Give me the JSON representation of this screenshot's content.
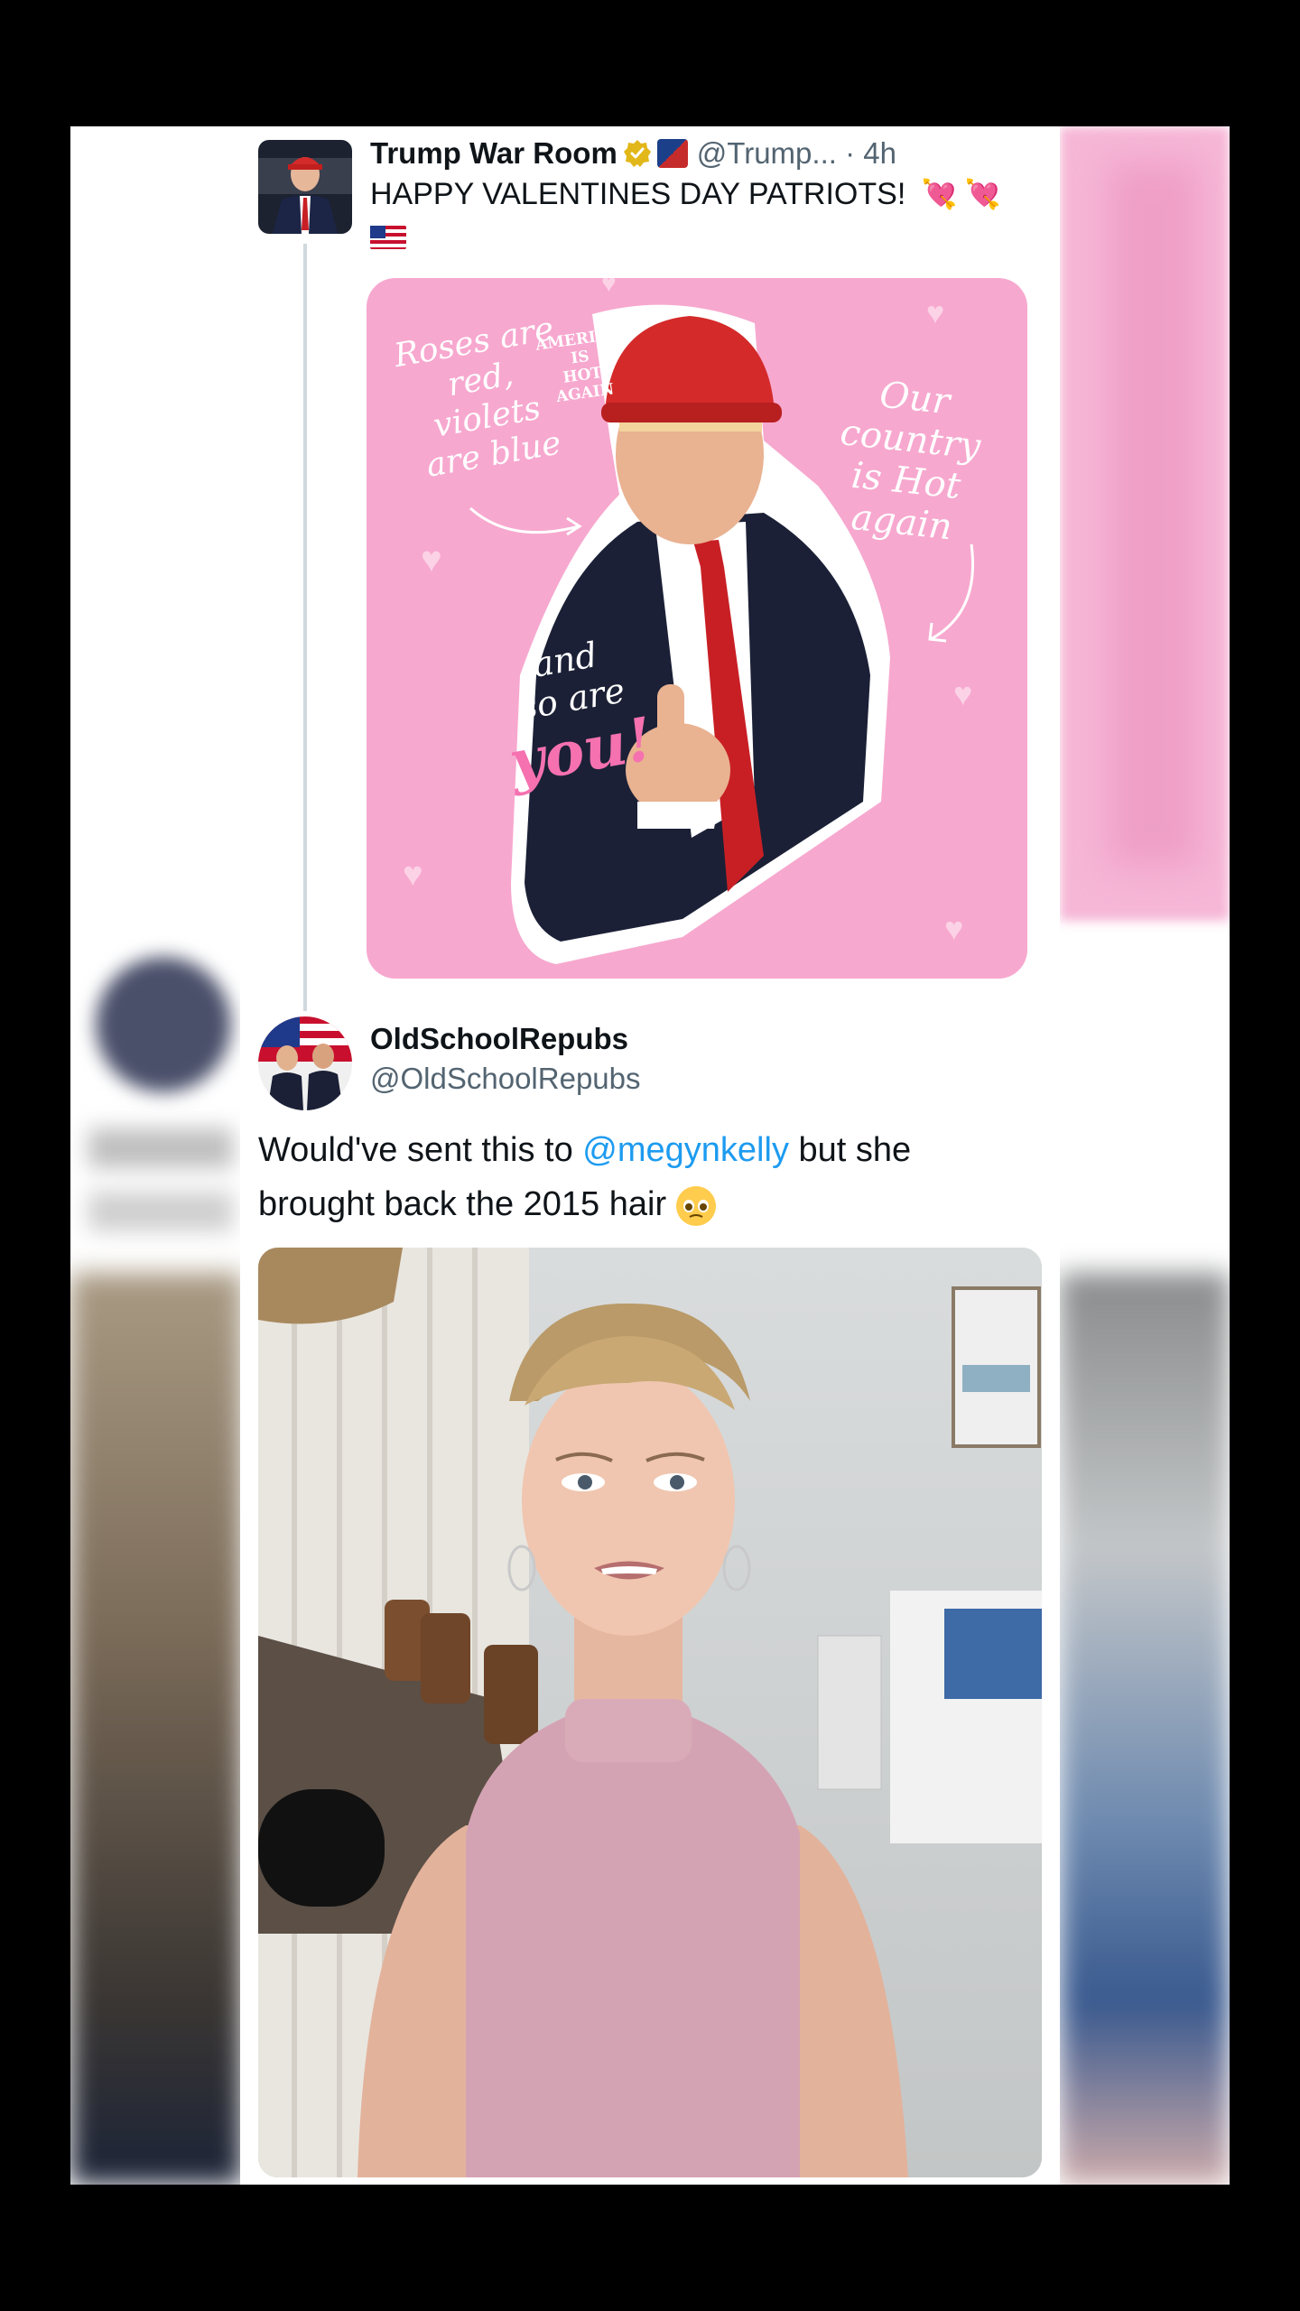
{
  "tweet1": {
    "display_name": "Trump War Room",
    "handle_time": "@Trump... · 4h",
    "text": "HAPPY VALENTINES DAY PATRIOTS!",
    "image": {
      "hat_text_line1": "AMERICA IS",
      "hat_text_line2": "HOT AGAIN",
      "left_line1": "Roses are",
      "left_line2": "red,",
      "left_line3": "violets",
      "left_line4": "are blue",
      "right_line1": "Our",
      "right_line2": "country",
      "right_line3": "is Hot",
      "right_line4": "again",
      "bottom_line1": "and",
      "bottom_line2": "so are",
      "bottom_line3": "you!"
    }
  },
  "tweet2": {
    "display_name": "OldSchoolRepubs",
    "handle": "@OldSchoolRepubs",
    "text_before": "Would've sent this to ",
    "mention": "@megynkelly",
    "text_after": " but she brought back the 2015 hair"
  },
  "icons": {
    "verified": "verified-badge-icon",
    "affiliate": "affiliate-badge-icon",
    "hearts": "heart-with-arrow-emoji",
    "flag": "us-flag-emoji",
    "pleading": "pleading-face-emoji"
  },
  "colors": {
    "card_pink": "#f7a8cf",
    "mention_blue": "#1d9bf0",
    "hat_red": "#d42a2a",
    "tie_red": "#c81f25"
  }
}
